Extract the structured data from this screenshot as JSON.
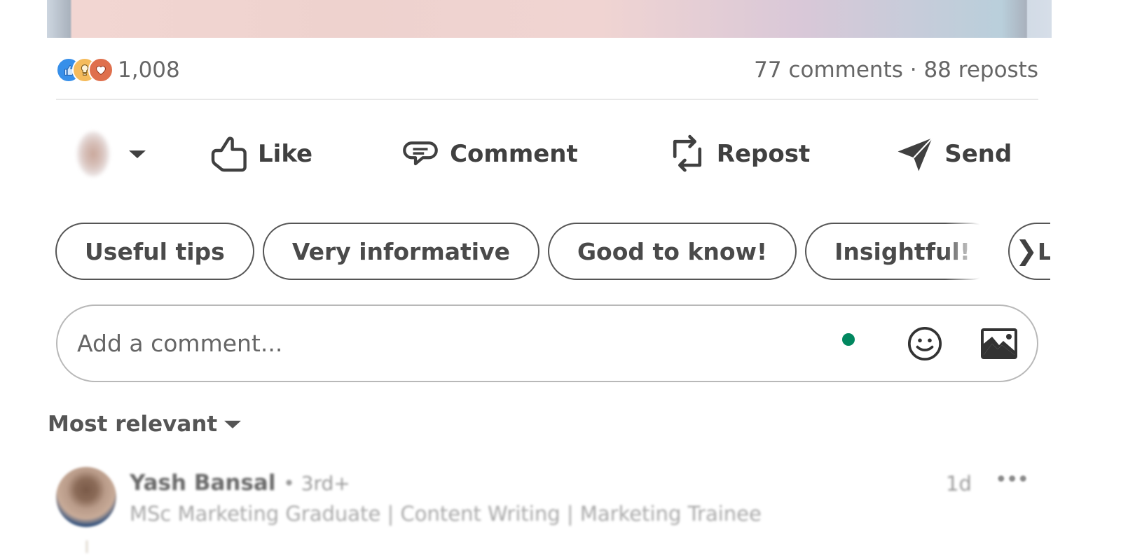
{
  "post": {
    "reactions": {
      "types": [
        "like-icon",
        "insightful-icon",
        "love-icon"
      ],
      "colors": {
        "like": "#378fe9",
        "insightful": "#f5bb5c",
        "love": "#df704d"
      },
      "count": "1,008"
    },
    "comments_reposts": "77 comments · 88 reposts"
  },
  "actions": {
    "like": "Like",
    "comment": "Comment",
    "repost": "Repost",
    "send": "Send"
  },
  "suggestion_chips": [
    "Useful tips",
    "Very informative",
    "Good to know!",
    "Insightful!",
    "Love this"
  ],
  "comment_box": {
    "placeholder": "Add a comment...",
    "status_color": "#01875f"
  },
  "sort": {
    "selected": "Most relevant"
  },
  "comments": [
    {
      "author": "Yash Bansal",
      "degree": "• 3rd+",
      "headline": "MSc Marketing Graduate | Content Writing | Marketing Trainee",
      "time": "1d",
      "more": "•••"
    }
  ]
}
